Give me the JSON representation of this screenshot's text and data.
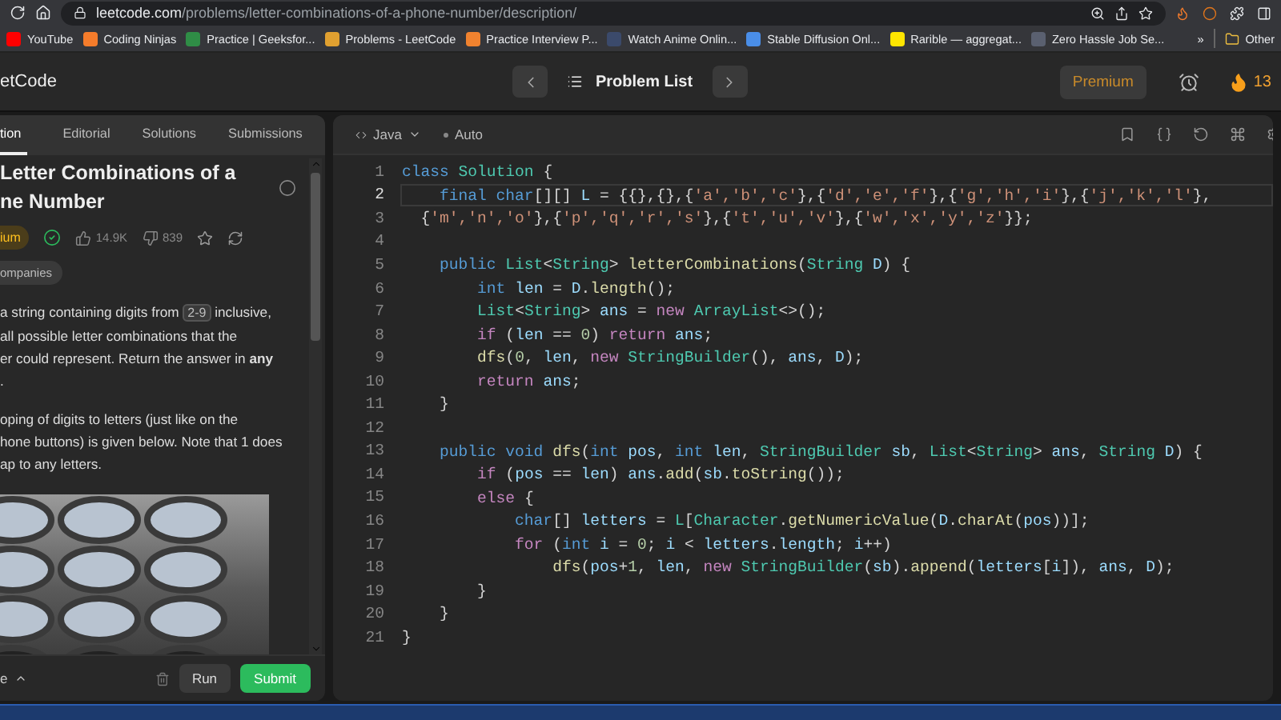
{
  "browser": {
    "url": {
      "host": "leetcode.com",
      "path": "/problems/letter-combinations-of-a-phone-number/description/"
    },
    "bookmarks": [
      {
        "label": "YouTube",
        "color": "#ff0000"
      },
      {
        "label": "Coding Ninjas",
        "color": "#f57c2b"
      },
      {
        "label": "Practice | Geeksfor...",
        "color": "#2f8d46"
      },
      {
        "label": "Problems - LeetCode",
        "color": "#e0a030"
      },
      {
        "label": "Practice Interview P...",
        "color": "#f0822f"
      },
      {
        "label": "Watch Anime Onlin...",
        "color": "#3b4a6b"
      },
      {
        "label": "Stable Diffusion Onl...",
        "color": "#4a8ee8"
      },
      {
        "label": "Rarible — aggregat...",
        "color": "#fee500"
      },
      {
        "label": "Zero Hassle Job Se...",
        "color": "#5a6070"
      }
    ],
    "more": "»",
    "other": "Other"
  },
  "header": {
    "brand": "etCode",
    "nav_title": "Problem List",
    "premium": "Premium",
    "streak": "13"
  },
  "problem": {
    "tabs": [
      {
        "label": "tion",
        "selected": true
      },
      {
        "label": "Editorial",
        "selected": false
      },
      {
        "label": "Solutions",
        "selected": false
      },
      {
        "label": "Submissions",
        "selected": false
      }
    ],
    "title_lines": [
      "Letter Combinations of a",
      "ne Number"
    ],
    "difficulty": "ium",
    "solved": true,
    "likes": "14.9K",
    "dislikes": "839",
    "tag": "ompanies",
    "paragraphs": [
      [
        [
          {
            "kind": "text",
            "text": "a string containing digits from "
          },
          {
            "kind": "code",
            "text": "2-9"
          },
          {
            "kind": "text",
            "text": " inclusive,"
          }
        ],
        [
          {
            "kind": "text",
            "text": "all possible letter combinations that the"
          }
        ],
        [
          {
            "kind": "text",
            "text": "er could represent. Return the answer in "
          },
          {
            "kind": "bold",
            "text": "any"
          }
        ],
        [
          {
            "kind": "text",
            "text": "."
          }
        ]
      ],
      [
        [
          {
            "kind": "text",
            "text": "oping of digits to letters (just like on the"
          }
        ],
        [
          {
            "kind": "text",
            "text": "hone buttons) is given below. Note that 1 does"
          }
        ],
        [
          {
            "kind": "text",
            "text": "ap to any letters."
          }
        ]
      ]
    ],
    "figure": {
      "kind": "picture"
    },
    "console": "e",
    "run": "Run",
    "submit": "Submit"
  },
  "editor": {
    "language": "Java",
    "mode": "Auto",
    "lines": [
      {
        "number": "1",
        "current": false,
        "tokens": [
          {
            "kind": "kw",
            "text": "class "
          },
          {
            "kind": "type",
            "text": "Solution"
          },
          {
            "kind": "punct",
            "text": " {"
          }
        ]
      },
      {
        "number": "2",
        "current": true,
        "tokens": [
          {
            "kind": "kw",
            "text": "    final char"
          },
          {
            "kind": "punct",
            "text": "[][] "
          },
          {
            "kind": "var",
            "text": "L"
          },
          {
            "kind": "punct",
            "text": " = {{},{},{"
          },
          {
            "kind": "str",
            "text": "'a','b','c'"
          },
          {
            "kind": "punct",
            "text": "},{"
          },
          {
            "kind": "str",
            "text": "'d','e','f'"
          },
          {
            "kind": "punct",
            "text": "},{"
          },
          {
            "kind": "str",
            "text": "'g','h','i'"
          },
          {
            "kind": "punct",
            "text": "},{"
          },
          {
            "kind": "str",
            "text": "'j','k','l'"
          },
          {
            "kind": "punct",
            "text": "},"
          }
        ]
      },
      {
        "number": "3",
        "current": false,
        "tokens": [
          {
            "kind": "punct",
            "text": "  {"
          },
          {
            "kind": "str",
            "text": "'m','n','o'"
          },
          {
            "kind": "punct",
            "text": "},{"
          },
          {
            "kind": "str",
            "text": "'p','q','r','s'"
          },
          {
            "kind": "punct",
            "text": "},{"
          },
          {
            "kind": "str",
            "text": "'t','u','v'"
          },
          {
            "kind": "punct",
            "text": "},{"
          },
          {
            "kind": "str",
            "text": "'w','x','y','z'"
          },
          {
            "kind": "punct",
            "text": "}};"
          }
        ]
      },
      {
        "number": "4",
        "current": false
      },
      {
        "number": "5",
        "current": false,
        "tokens": [
          {
            "kind": "kw",
            "text": "    public "
          },
          {
            "kind": "type",
            "text": "List"
          },
          {
            "kind": "punct",
            "text": "<"
          },
          {
            "kind": "type",
            "text": "String"
          },
          {
            "kind": "punct",
            "text": "> "
          },
          {
            "kind": "fn",
            "text": "letterCombinations"
          },
          {
            "kind": "punct",
            "text": "("
          },
          {
            "kind": "type",
            "text": "String "
          },
          {
            "kind": "var",
            "text": "D"
          },
          {
            "kind": "punct",
            "text": ") {"
          }
        ]
      },
      {
        "number": "6",
        "current": false,
        "tokens": [
          {
            "kind": "kw",
            "text": "        int "
          },
          {
            "kind": "var",
            "text": "len"
          },
          {
            "kind": "punct",
            "text": " = "
          },
          {
            "kind": "var",
            "text": "D"
          },
          {
            "kind": "punct",
            "text": "."
          },
          {
            "kind": "fn",
            "text": "length"
          },
          {
            "kind": "punct",
            "text": "();"
          }
        ]
      },
      {
        "number": "7",
        "current": false,
        "tokens": [
          {
            "kind": "type",
            "text": "        List"
          },
          {
            "kind": "punct",
            "text": "<"
          },
          {
            "kind": "type",
            "text": "String"
          },
          {
            "kind": "punct",
            "text": "> "
          },
          {
            "kind": "var",
            "text": "ans"
          },
          {
            "kind": "punct",
            "text": " = "
          },
          {
            "kind": "ctl",
            "text": "new "
          },
          {
            "kind": "type",
            "text": "ArrayList"
          },
          {
            "kind": "punct",
            "text": "<>();"
          }
        ]
      },
      {
        "number": "8",
        "current": false,
        "tokens": [
          {
            "kind": "ctl",
            "text": "        if "
          },
          {
            "kind": "punct",
            "text": "("
          },
          {
            "kind": "var",
            "text": "len"
          },
          {
            "kind": "punct",
            "text": " == "
          },
          {
            "kind": "num",
            "text": "0"
          },
          {
            "kind": "punct",
            "text": ") "
          },
          {
            "kind": "ctl",
            "text": "return "
          },
          {
            "kind": "var",
            "text": "ans"
          },
          {
            "kind": "punct",
            "text": ";"
          }
        ]
      },
      {
        "number": "9",
        "current": false,
        "tokens": [
          {
            "kind": "fn",
            "text": "        dfs"
          },
          {
            "kind": "punct",
            "text": "("
          },
          {
            "kind": "num",
            "text": "0"
          },
          {
            "kind": "punct",
            "text": ", "
          },
          {
            "kind": "var",
            "text": "len"
          },
          {
            "kind": "punct",
            "text": ", "
          },
          {
            "kind": "ctl",
            "text": "new "
          },
          {
            "kind": "type",
            "text": "StringBuilder"
          },
          {
            "kind": "punct",
            "text": "(), "
          },
          {
            "kind": "var",
            "text": "ans"
          },
          {
            "kind": "punct",
            "text": ", "
          },
          {
            "kind": "var",
            "text": "D"
          },
          {
            "kind": "punct",
            "text": ");"
          }
        ]
      },
      {
        "number": "10",
        "current": false,
        "tokens": [
          {
            "kind": "ctl",
            "text": "        return "
          },
          {
            "kind": "var",
            "text": "ans"
          },
          {
            "kind": "punct",
            "text": ";"
          }
        ]
      },
      {
        "number": "11",
        "current": false,
        "tokens": [
          {
            "kind": "punct",
            "text": "    }"
          }
        ]
      },
      {
        "number": "12",
        "current": false
      },
      {
        "number": "13",
        "current": false,
        "tokens": [
          {
            "kind": "kw",
            "text": "    public void "
          },
          {
            "kind": "fn",
            "text": "dfs"
          },
          {
            "kind": "punct",
            "text": "("
          },
          {
            "kind": "kw",
            "text": "int "
          },
          {
            "kind": "var",
            "text": "pos"
          },
          {
            "kind": "punct",
            "text": ", "
          },
          {
            "kind": "kw",
            "text": "int "
          },
          {
            "kind": "var",
            "text": "len"
          },
          {
            "kind": "punct",
            "text": ", "
          },
          {
            "kind": "type",
            "text": "StringBuilder "
          },
          {
            "kind": "var",
            "text": "sb"
          },
          {
            "kind": "punct",
            "text": ", "
          },
          {
            "kind": "type",
            "text": "List"
          },
          {
            "kind": "punct",
            "text": "<"
          },
          {
            "kind": "type",
            "text": "String"
          },
          {
            "kind": "punct",
            "text": "> "
          },
          {
            "kind": "var",
            "text": "ans"
          },
          {
            "kind": "punct",
            "text": ", "
          },
          {
            "kind": "type",
            "text": "String "
          },
          {
            "kind": "var",
            "text": "D"
          },
          {
            "kind": "punct",
            "text": ") {"
          }
        ]
      },
      {
        "number": "14",
        "current": false,
        "tokens": [
          {
            "kind": "ctl",
            "text": "        if "
          },
          {
            "kind": "punct",
            "text": "("
          },
          {
            "kind": "var",
            "text": "pos"
          },
          {
            "kind": "punct",
            "text": " == "
          },
          {
            "kind": "var",
            "text": "len"
          },
          {
            "kind": "punct",
            "text": ") "
          },
          {
            "kind": "var",
            "text": "ans"
          },
          {
            "kind": "punct",
            "text": "."
          },
          {
            "kind": "fn",
            "text": "add"
          },
          {
            "kind": "punct",
            "text": "("
          },
          {
            "kind": "var",
            "text": "sb"
          },
          {
            "kind": "punct",
            "text": "."
          },
          {
            "kind": "fn",
            "text": "toString"
          },
          {
            "kind": "punct",
            "text": "());"
          }
        ]
      },
      {
        "number": "15",
        "current": false,
        "tokens": [
          {
            "kind": "ctl",
            "text": "        else "
          },
          {
            "kind": "punct",
            "text": "{"
          }
        ]
      },
      {
        "number": "16",
        "current": false,
        "tokens": [
          {
            "kind": "kw",
            "text": "            char"
          },
          {
            "kind": "punct",
            "text": "[] "
          },
          {
            "kind": "var",
            "text": "letters"
          },
          {
            "kind": "punct",
            "text": " = "
          },
          {
            "kind": "type",
            "text": "L"
          },
          {
            "kind": "punct",
            "text": "["
          },
          {
            "kind": "type",
            "text": "Character"
          },
          {
            "kind": "punct",
            "text": "."
          },
          {
            "kind": "fn",
            "text": "getNumericValue"
          },
          {
            "kind": "punct",
            "text": "("
          },
          {
            "kind": "var",
            "text": "D"
          },
          {
            "kind": "punct",
            "text": "."
          },
          {
            "kind": "fn",
            "text": "charAt"
          },
          {
            "kind": "punct",
            "text": "("
          },
          {
            "kind": "var",
            "text": "pos"
          },
          {
            "kind": "punct",
            "text": "))];"
          }
        ]
      },
      {
        "number": "17",
        "current": false,
        "tokens": [
          {
            "kind": "ctl",
            "text": "            for "
          },
          {
            "kind": "punct",
            "text": "("
          },
          {
            "kind": "kw",
            "text": "int "
          },
          {
            "kind": "var",
            "text": "i"
          },
          {
            "kind": "punct",
            "text": " = "
          },
          {
            "kind": "num",
            "text": "0"
          },
          {
            "kind": "punct",
            "text": "; "
          },
          {
            "kind": "var",
            "text": "i"
          },
          {
            "kind": "punct",
            "text": " < "
          },
          {
            "kind": "var",
            "text": "letters"
          },
          {
            "kind": "punct",
            "text": "."
          },
          {
            "kind": "var",
            "text": "length"
          },
          {
            "kind": "punct",
            "text": "; "
          },
          {
            "kind": "var",
            "text": "i"
          },
          {
            "kind": "punct",
            "text": "++)"
          }
        ]
      },
      {
        "number": "18",
        "current": false,
        "tokens": [
          {
            "kind": "fn",
            "text": "                dfs"
          },
          {
            "kind": "punct",
            "text": "("
          },
          {
            "kind": "var",
            "text": "pos"
          },
          {
            "kind": "punct",
            "text": "+"
          },
          {
            "kind": "num",
            "text": "1"
          },
          {
            "kind": "punct",
            "text": ", "
          },
          {
            "kind": "var",
            "text": "len"
          },
          {
            "kind": "punct",
            "text": ", "
          },
          {
            "kind": "ctl",
            "text": "new "
          },
          {
            "kind": "type",
            "text": "StringBuilder"
          },
          {
            "kind": "punct",
            "text": "("
          },
          {
            "kind": "var",
            "text": "sb"
          },
          {
            "kind": "punct",
            "text": ")."
          },
          {
            "kind": "fn",
            "text": "append"
          },
          {
            "kind": "punct",
            "text": "("
          },
          {
            "kind": "var",
            "text": "letters"
          },
          {
            "kind": "punct",
            "text": "["
          },
          {
            "kind": "var",
            "text": "i"
          },
          {
            "kind": "punct",
            "text": "]), "
          },
          {
            "kind": "var",
            "text": "ans"
          },
          {
            "kind": "punct",
            "text": ", "
          },
          {
            "kind": "var",
            "text": "D"
          },
          {
            "kind": "punct",
            "text": ");"
          }
        ]
      },
      {
        "number": "19",
        "current": false,
        "tokens": [
          {
            "kind": "punct",
            "text": "        }"
          }
        ]
      },
      {
        "number": "20",
        "current": false,
        "tokens": [
          {
            "kind": "punct",
            "text": "    }"
          }
        ]
      },
      {
        "number": "21",
        "current": false,
        "tokens": [
          {
            "kind": "punct",
            "text": "}"
          }
        ]
      }
    ]
  }
}
